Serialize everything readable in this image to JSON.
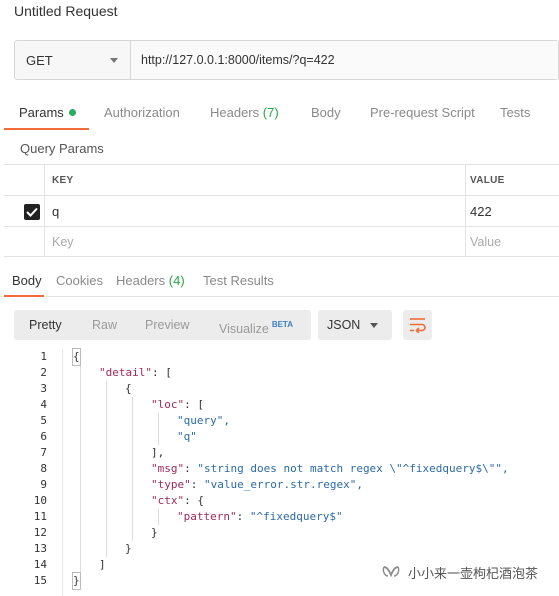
{
  "window": {
    "title": "Untitled Request"
  },
  "request": {
    "method": "GET",
    "url": "http://127.0.0.1:8000/items/?q=422"
  },
  "request_tabs": [
    {
      "label": "Params",
      "active": true,
      "has_dot": true
    },
    {
      "label": "Authorization"
    },
    {
      "label": "Headers",
      "count": "(7)"
    },
    {
      "label": "Body"
    },
    {
      "label": "Pre-request Script"
    },
    {
      "label": "Tests"
    }
  ],
  "query_params": {
    "title": "Query Params",
    "headers": {
      "key": "KEY",
      "value": "VALUE"
    },
    "rows": [
      {
        "key": "q",
        "value": "422",
        "checked": true
      }
    ],
    "new_row": {
      "key_placeholder": "Key",
      "value_placeholder": "Value"
    }
  },
  "response_tabs": [
    {
      "label": "Body",
      "active": true
    },
    {
      "label": "Cookies"
    },
    {
      "label": "Headers",
      "count": "(4)"
    },
    {
      "label": "Test Results"
    }
  ],
  "response_view": {
    "modes": [
      "Pretty",
      "Raw",
      "Preview",
      "Visualize"
    ],
    "active_mode": "Pretty",
    "visualize_badge": "BETA",
    "format": "JSON",
    "wrap_icon": "wrap-lines-icon"
  },
  "response_body": {
    "line_numbers": [
      "1",
      "2",
      "3",
      "4",
      "5",
      "6",
      "7",
      "8",
      "9",
      "10",
      "11",
      "12",
      "13",
      "14",
      "15"
    ],
    "lines": [
      "{",
      "\"detail\": [",
      "{",
      "\"loc\": [",
      "\"query\",",
      "\"q\"",
      "],",
      "\"msg\": \"string does not match regex \\\"^fixedquery$\\\"\",",
      "\"type\": \"value_error.str.regex\",",
      "\"ctx\": {",
      "\"pattern\": \"^fixedquery$\"",
      "}",
      "}",
      "]",
      "}"
    ]
  },
  "watermark": {
    "text": "小小来一壶枸杞酒泡茶",
    "icon": "wechat-channel-icon"
  },
  "colors": {
    "accent": "#f26b3a",
    "green": "#27a745",
    "json_key": "#a0295d",
    "json_string": "#2b6ba6"
  }
}
